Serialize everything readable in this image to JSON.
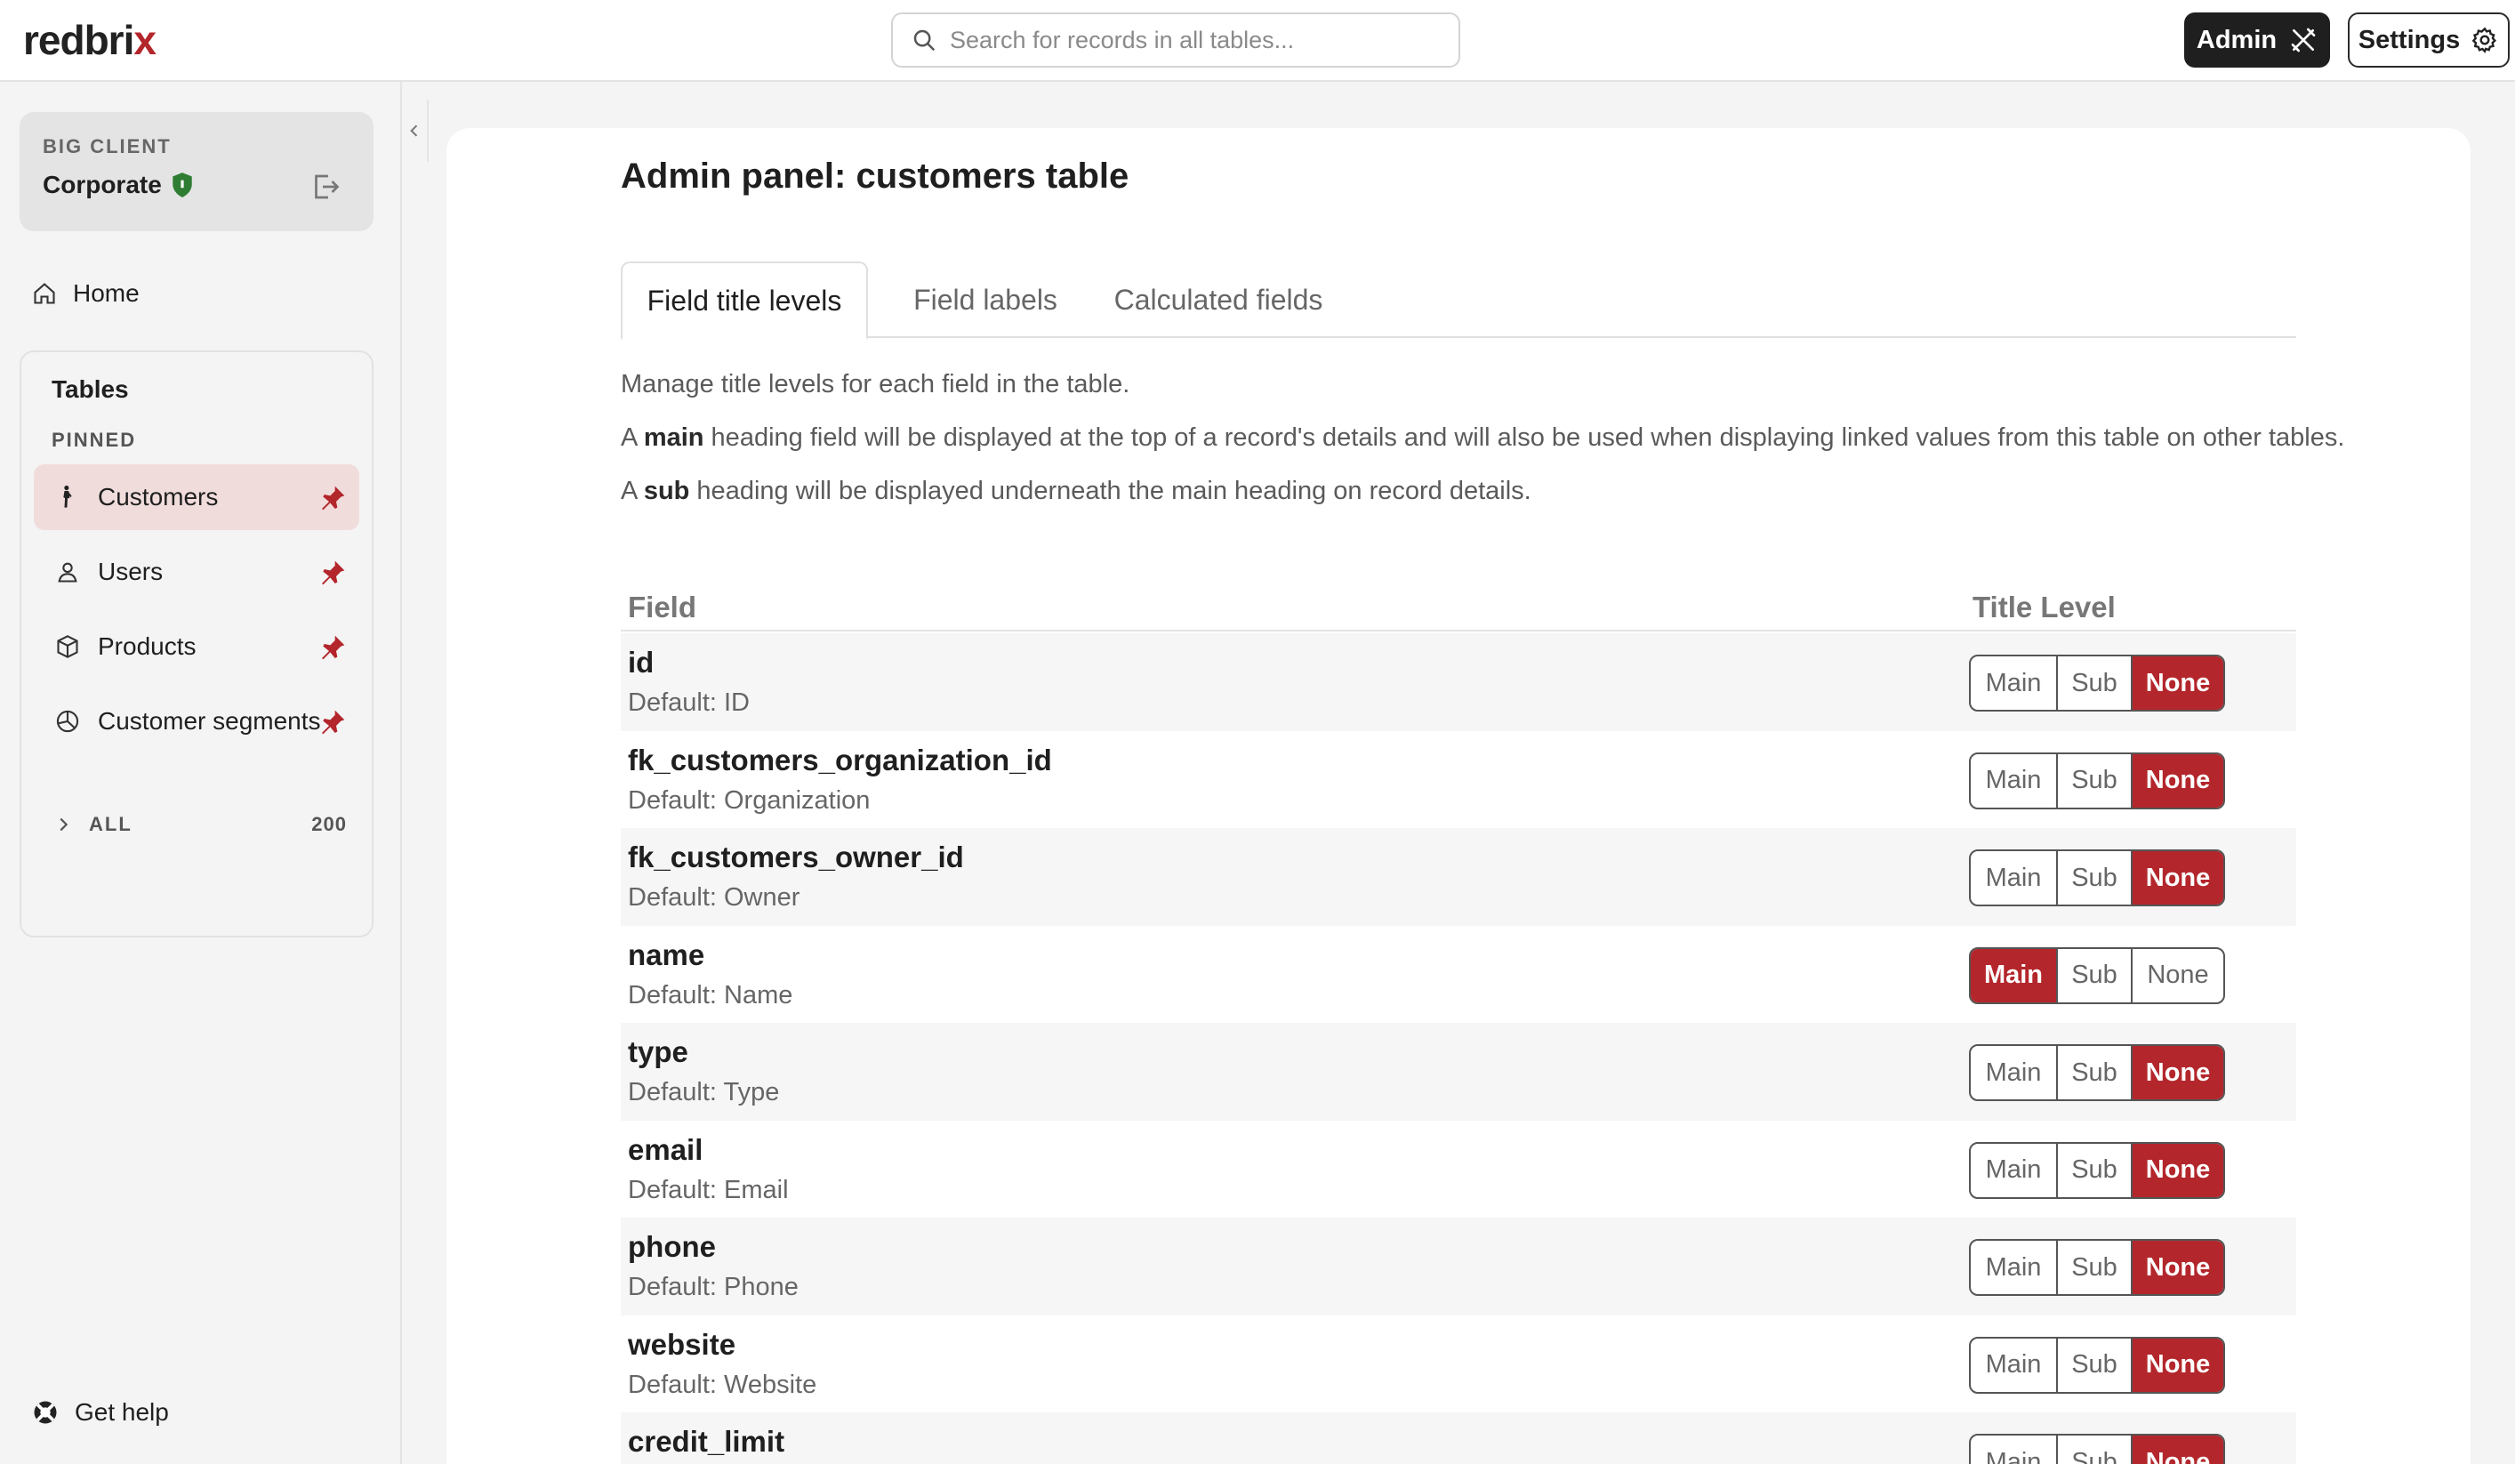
{
  "app": {
    "logo_main": "redbri",
    "logo_accent": "x"
  },
  "header": {
    "search_placeholder": "Search for records in all tables...",
    "admin_label": "Admin",
    "settings_label": "Settings"
  },
  "sidebar": {
    "client_label": "BIG CLIENT",
    "client_name": "Corporate",
    "home_label": "Home",
    "tables_title": "Tables",
    "pinned_label": "PINNED",
    "items": [
      {
        "label": "Customers",
        "icon": "person-standing-icon",
        "active": true
      },
      {
        "label": "Users",
        "icon": "user-icon",
        "active": false
      },
      {
        "label": "Products",
        "icon": "box-icon",
        "active": false
      },
      {
        "label": "Customer segments",
        "icon": "pie-chart-icon",
        "active": false
      }
    ],
    "all_label": "ALL",
    "all_count": "200",
    "help_label": "Get help"
  },
  "main": {
    "title": "Admin panel: customers table",
    "tabs": [
      {
        "label": "Field title levels",
        "active": true
      },
      {
        "label": "Field labels",
        "active": false
      },
      {
        "label": "Calculated fields",
        "active": false
      }
    ],
    "desc_1": "Manage title levels for each field in the table.",
    "desc_2_pre": "A ",
    "desc_2_bold": "main",
    "desc_2_post": " heading field will be displayed at the top of a record's details and will also be used when displaying linked values from this table on other tables.",
    "desc_3_pre": "A ",
    "desc_3_bold": "sub",
    "desc_3_post": " heading will be displayed underneath the main heading on record details.",
    "col_field": "Field",
    "col_level": "Title Level",
    "level_options": [
      "Main",
      "Sub",
      "None"
    ],
    "rows": [
      {
        "field": "id",
        "default": "Default: ID",
        "level": "None"
      },
      {
        "field": "fk_customers_organization_id",
        "default": "Default: Organization",
        "level": "None"
      },
      {
        "field": "fk_customers_owner_id",
        "default": "Default: Owner",
        "level": "None"
      },
      {
        "field": "name",
        "default": "Default: Name",
        "level": "Main"
      },
      {
        "field": "type",
        "default": "Default: Type",
        "level": "None"
      },
      {
        "field": "email",
        "default": "Default: Email",
        "level": "None"
      },
      {
        "field": "phone",
        "default": "Default: Phone",
        "level": "None"
      },
      {
        "field": "website",
        "default": "Default: Website",
        "level": "None"
      },
      {
        "field": "credit_limit",
        "default": "",
        "level": "None"
      }
    ]
  },
  "colors": {
    "accent": "#b3262b",
    "active_nav_bg": "#f1dcdc",
    "shield": "#2e7d32"
  }
}
